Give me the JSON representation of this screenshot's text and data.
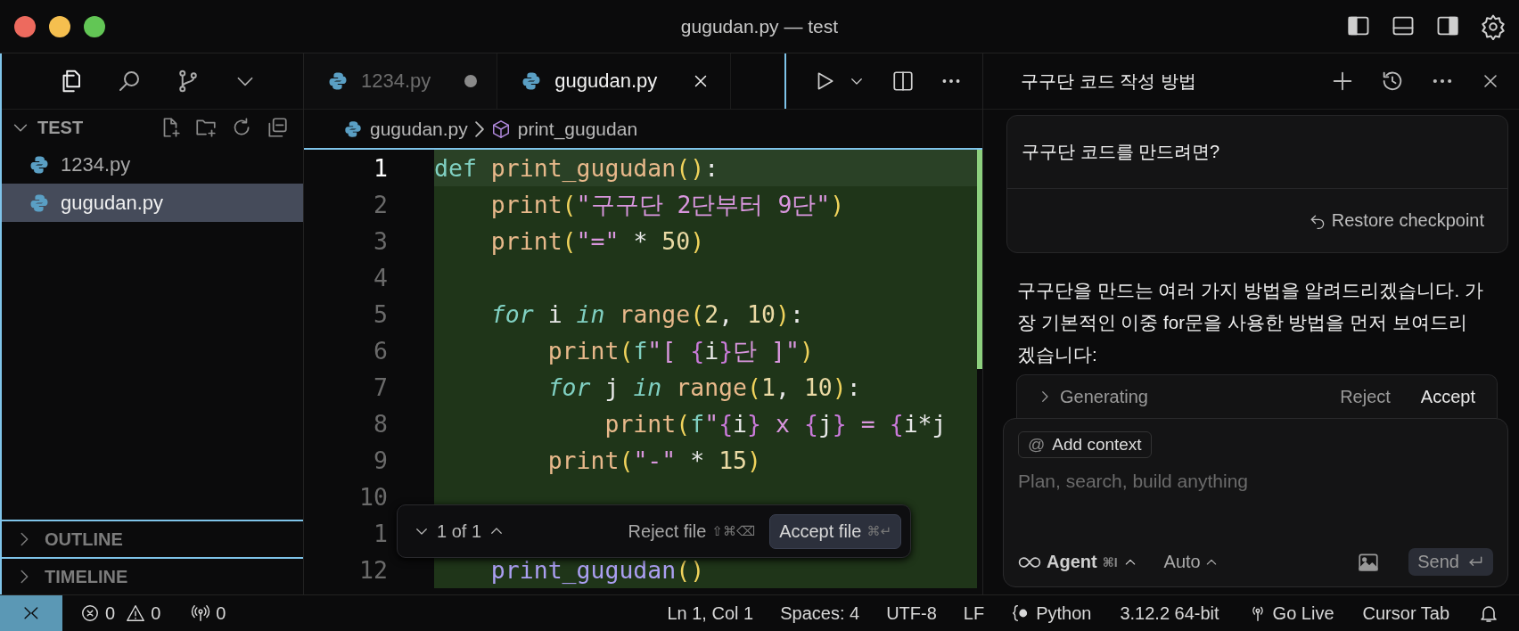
{
  "window": {
    "title": "gugudan.py — test"
  },
  "sidebar": {
    "sections": [
      {
        "title": "TEST",
        "expanded": true,
        "files": [
          {
            "name": "1234.py",
            "selected": false
          },
          {
            "name": "gugudan.py",
            "selected": true
          }
        ]
      },
      {
        "title": "OUTLINE",
        "expanded": false
      },
      {
        "title": "TIMELINE",
        "expanded": false
      }
    ]
  },
  "editor": {
    "tabs": [
      {
        "label": "1234.py",
        "selected": false,
        "modified": true
      },
      {
        "label": "gugudan.py",
        "selected": true,
        "modified": false
      }
    ],
    "breadcrumb": [
      "gugudan.py",
      "print_gugudan"
    ],
    "lines": [
      {
        "number": "1",
        "current": true,
        "added": true,
        "tokens": [
          {
            "kind": "kw",
            "text": "def "
          },
          {
            "kind": "fn",
            "text": "print_gugudan"
          },
          {
            "kind": "paren",
            "text": "()"
          },
          {
            "kind": "plain",
            "text": ":"
          }
        ]
      },
      {
        "number": "2",
        "current": false,
        "added": true,
        "tokens": [
          {
            "kind": "fn",
            "text": "    print"
          },
          {
            "kind": "paren",
            "text": "("
          },
          {
            "kind": "str",
            "text": "\"구구단 2단부터 9단\""
          },
          {
            "kind": "paren",
            "text": ")"
          }
        ]
      },
      {
        "number": "3",
        "current": false,
        "added": true,
        "tokens": [
          {
            "kind": "fn",
            "text": "    print"
          },
          {
            "kind": "paren",
            "text": "("
          },
          {
            "kind": "str",
            "text": "\"=\""
          },
          {
            "kind": "plain",
            "text": " * "
          },
          {
            "kind": "num",
            "text": "50"
          },
          {
            "kind": "paren",
            "text": ")"
          }
        ]
      },
      {
        "number": "4",
        "current": false,
        "added": true
      },
      {
        "number": "5",
        "current": false,
        "added": true,
        "tokens": [
          {
            "kind": "ctrl",
            "text": "    for"
          },
          {
            "kind": "plain",
            "text": " i "
          },
          {
            "kind": "ctrl",
            "text": "in"
          },
          {
            "kind": "fn",
            "text": " range"
          },
          {
            "kind": "paren",
            "text": "("
          },
          {
            "kind": "num",
            "text": "2"
          },
          {
            "kind": "plain",
            "text": ", "
          },
          {
            "kind": "num",
            "text": "10"
          },
          {
            "kind": "paren",
            "text": ")"
          },
          {
            "kind": "plain",
            "text": ":"
          }
        ]
      },
      {
        "number": "6",
        "current": false,
        "added": true,
        "tokens": [
          {
            "kind": "fn",
            "text": "        print"
          },
          {
            "kind": "paren",
            "text": "("
          },
          {
            "kind": "kw",
            "text": "f"
          },
          {
            "kind": "str",
            "text": "\"[ "
          },
          {
            "kind": "brace",
            "text": "{"
          },
          {
            "kind": "plain",
            "text": "i"
          },
          {
            "kind": "brace",
            "text": "}"
          },
          {
            "kind": "str",
            "text": "단 ]\""
          },
          {
            "kind": "paren",
            "text": ")"
          }
        ]
      },
      {
        "number": "7",
        "current": false,
        "added": true,
        "tokens": [
          {
            "kind": "ctrl",
            "text": "        for"
          },
          {
            "kind": "plain",
            "text": " j "
          },
          {
            "kind": "ctrl",
            "text": "in"
          },
          {
            "kind": "fn",
            "text": " range"
          },
          {
            "kind": "paren",
            "text": "("
          },
          {
            "kind": "num",
            "text": "1"
          },
          {
            "kind": "plain",
            "text": ", "
          },
          {
            "kind": "num",
            "text": "10"
          },
          {
            "kind": "paren",
            "text": ")"
          },
          {
            "kind": "plain",
            "text": ":"
          }
        ]
      },
      {
        "number": "8",
        "current": false,
        "added": true,
        "tokens": [
          {
            "kind": "fn",
            "text": "            print"
          },
          {
            "kind": "paren",
            "text": "("
          },
          {
            "kind": "kw",
            "text": "f"
          },
          {
            "kind": "str",
            "text": "\""
          },
          {
            "kind": "brace",
            "text": "{"
          },
          {
            "kind": "plain",
            "text": "i"
          },
          {
            "kind": "brace",
            "text": "}"
          },
          {
            "kind": "str",
            "text": " x "
          },
          {
            "kind": "brace",
            "text": "{"
          },
          {
            "kind": "plain",
            "text": "j"
          },
          {
            "kind": "brace",
            "text": "}"
          },
          {
            "kind": "str",
            "text": " = "
          },
          {
            "kind": "brace",
            "text": "{"
          },
          {
            "kind": "plain",
            "text": "i*j"
          }
        ]
      },
      {
        "number": "9",
        "current": false,
        "added": true,
        "tokens": [
          {
            "kind": "fn",
            "text": "        print"
          },
          {
            "kind": "paren",
            "text": "("
          },
          {
            "kind": "str",
            "text": "\"-\""
          },
          {
            "kind": "plain",
            "text": " * "
          },
          {
            "kind": "num",
            "text": "15"
          },
          {
            "kind": "paren",
            "text": ")"
          }
        ]
      },
      {
        "number": "10",
        "current": false,
        "added": true
      },
      {
        "number": "1",
        "current": false,
        "added": true
      },
      {
        "number": "12",
        "current": false,
        "added": true,
        "tokens": [
          {
            "kind": "call",
            "text": "    print_gugudan"
          },
          {
            "kind": "paren",
            "text": "()"
          }
        ]
      }
    ],
    "review_bar": {
      "position": "1 of 1",
      "reject": "Reject file",
      "reject_shortcut": "⇧⌘⌫",
      "accept": "Accept file",
      "accept_shortcut": "⌘↵"
    }
  },
  "chat": {
    "title": "구구단 코드 작성 방법",
    "user_message": "구구단 코드를 만드려면?",
    "restore": "Restore checkpoint",
    "reply": "구구단을 만드는 여러 가지 방법을 알려드리겠습니다. 가장 기본적인 이중 for문을 사용한 방법을 먼저 보여드리겠습니다:",
    "generating": {
      "label": "Generating",
      "reject": "Reject",
      "accept": "Accept"
    },
    "composer": {
      "context_icon": "@",
      "context_label": "Add context",
      "placeholder": "Plan, search, build anything",
      "mode": "Agent",
      "mode_shortcut": "⌘I",
      "model": "Auto",
      "send": "Send"
    }
  },
  "status_bar": {
    "errors": "0",
    "warnings": "0",
    "ports": "0",
    "items": [
      "Ln 1, Col 1",
      "Spaces: 4",
      "UTF-8",
      "LF"
    ],
    "language": "Python",
    "interpreter": "3.12.2 64-bit",
    "go_live": "Go Live",
    "cursor_tab": "Cursor Tab"
  }
}
